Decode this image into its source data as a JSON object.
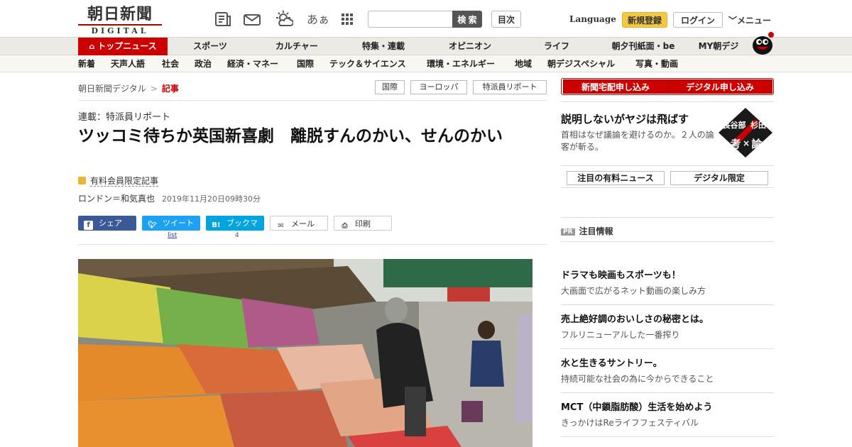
{
  "header": {
    "logo_jp": "朝日新聞",
    "logo_en": "DIGITAL",
    "icons": [
      "newspaper-icon",
      "mail-icon",
      "weather-icon",
      "font-size-icon",
      "grid-menu-icon"
    ],
    "font_icon_text": "あぁ",
    "search_placeholder": "",
    "search_label": "検 索",
    "toc_label": "目次",
    "language_label": "Language",
    "register_label": "新規登録",
    "login_label": "ログイン",
    "menu_label": "メニュー"
  },
  "nav_primary": [
    {
      "label": "トップニュース",
      "active": true
    },
    {
      "label": "スポーツ"
    },
    {
      "label": "カルチャー"
    },
    {
      "label": "特集・連載"
    },
    {
      "label": "オピニオン"
    },
    {
      "label": "ライフ"
    },
    {
      "label": "朝夕刊紙面・be"
    },
    {
      "label": "MY朝デジ"
    }
  ],
  "nav_secondary": [
    "新着",
    "天声人語",
    "社会",
    "政治",
    "経済・マネー",
    "国際",
    "テック＆サイエンス",
    "環境・エネルギー",
    "地域",
    "朝デジスペシャル",
    "写真・動画"
  ],
  "breadcrumb": {
    "home": "朝日新聞デジタル",
    "separator": ">",
    "current": "記事"
  },
  "tags": [
    "国際",
    "ヨーロッパ",
    "特派員リポート"
  ],
  "article": {
    "series": "連載：特派員リポート",
    "headline": "ツッコミ待ちか英国新喜劇　離脱すんのかい、せんのかい",
    "paid_label": "有料会員限定記事",
    "byline": "ロンドン＝和気真也",
    "date": "2019年11月20日09時30分"
  },
  "share": {
    "facebook": "シェア",
    "twitter": "ツイート",
    "twitter_sub": "list",
    "hatena": "ブックマーク",
    "hatena_count": "4",
    "mail": "メール",
    "print": "印刷"
  },
  "sidebar": {
    "subscribe_paper": "新聞宅配申し込み",
    "subscribe_digital": "デジタル申し込み",
    "promo_title": "説明しないがヤジは飛ばす",
    "promo_desc": "首相はなぜ議論を避けるのか。２人の論客が斬る。",
    "promo_badge": {
      "top_left": "長谷部",
      "top_right": "杉田",
      "bottom_left": "考",
      "bottom_mid": "×",
      "bottom_right": "論"
    },
    "tab_paid_news": "注目の有料ニュース",
    "tab_digital_only": "デジタル限定",
    "pr_badge": "PR",
    "pr_label": "注目情報",
    "ads": [
      {
        "title": "ドラマも映画もスポーツも！",
        "desc": "大画面で広がるネット動画の楽しみ方"
      },
      {
        "title": "売上絶好調のおいしさの秘密とは。",
        "desc": "フルリニューアルした一番搾り"
      },
      {
        "title": "水と生きるサントリー。",
        "desc": "持続可能な社会の為に今からできること"
      },
      {
        "title": "MCT（中鎖脂肪酸）生活を始めよう",
        "desc": "きっかけはReライフフェスティバル"
      }
    ]
  },
  "colors": {
    "brand_red": "#cc0000",
    "register_yellow": "#f5c842",
    "facebook": "#3b5998",
    "twitter": "#1da1f2",
    "hatena": "#00a4de"
  }
}
